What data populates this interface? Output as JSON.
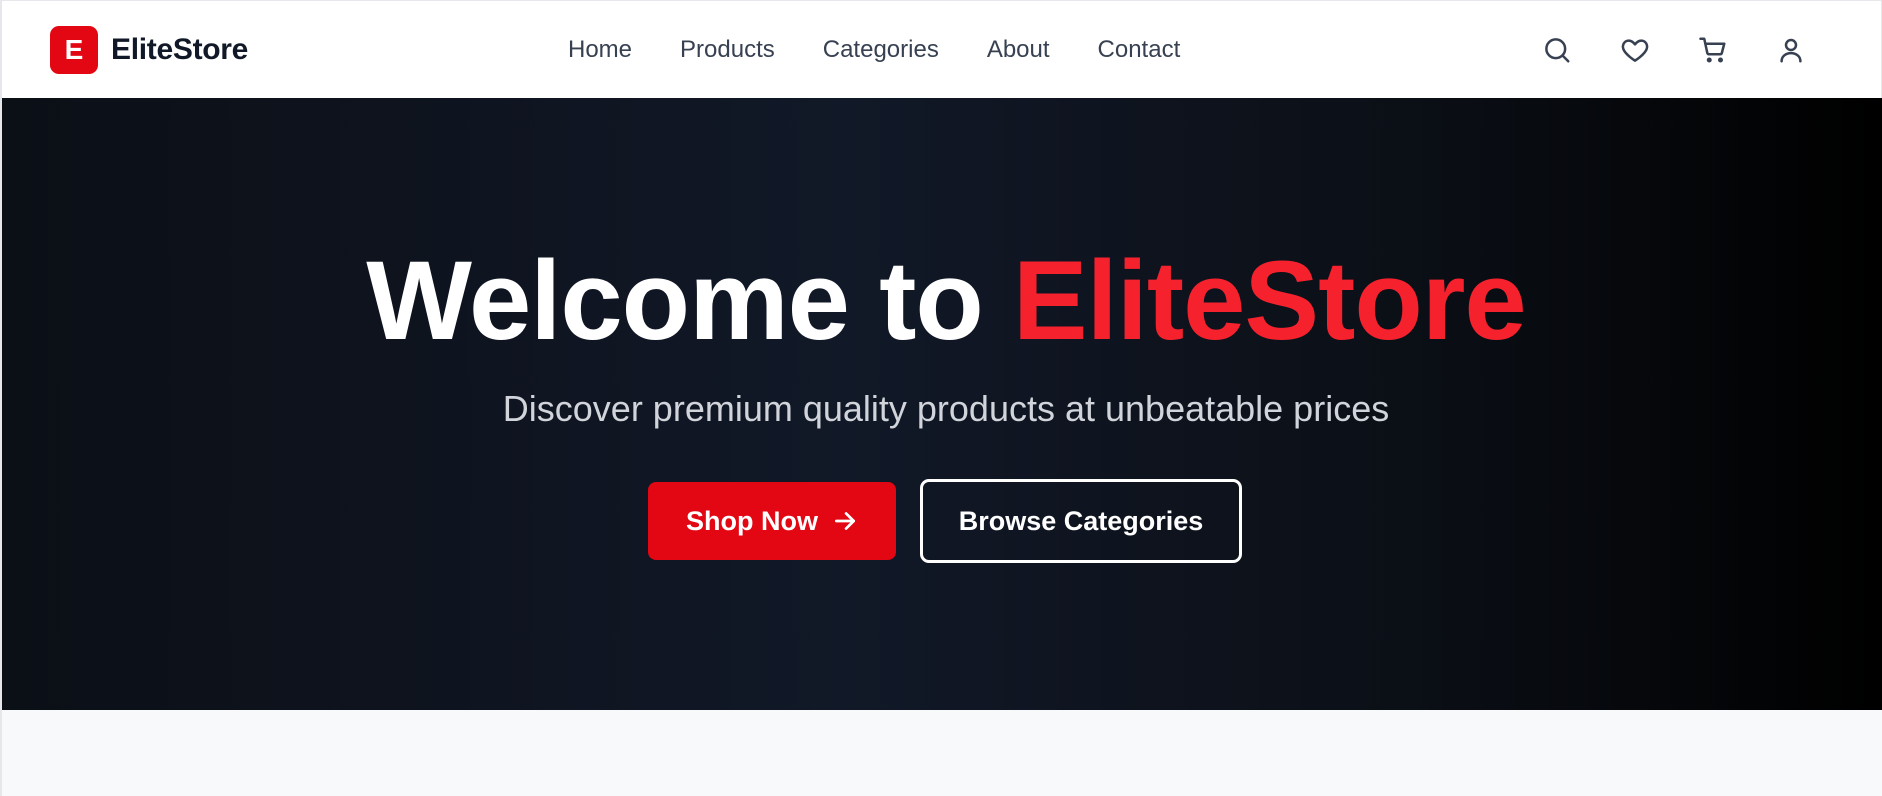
{
  "brand": {
    "logo_letter": "E",
    "name": "EliteStore",
    "accent_color": "#e30613"
  },
  "nav": {
    "items": [
      {
        "label": "Home"
      },
      {
        "label": "Products"
      },
      {
        "label": "Categories"
      },
      {
        "label": "About"
      },
      {
        "label": "Contact"
      }
    ]
  },
  "actions": {
    "icons": [
      "search-icon",
      "heart-icon",
      "cart-icon",
      "user-icon"
    ]
  },
  "hero": {
    "title_prefix": "Welcome to ",
    "title_accent": "EliteStore",
    "subtitle": "Discover premium quality products at unbeatable prices",
    "primary_button": "Shop Now",
    "secondary_button": "Browse Categories"
  }
}
